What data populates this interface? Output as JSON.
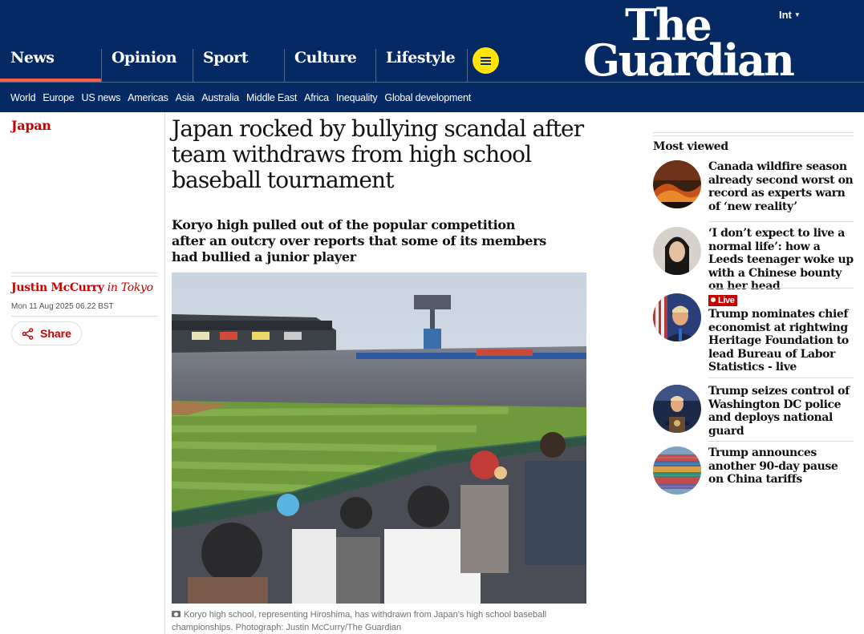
{
  "header": {
    "edition": "Int",
    "logo_line1": "The",
    "logo_line2": "Guardian",
    "pillars": [
      "News",
      "Opinion",
      "Sport",
      "Culture",
      "Lifestyle"
    ],
    "subnav": [
      "World",
      "Europe",
      "US news",
      "Americas",
      "Asia",
      "Australia",
      "Middle East",
      "Africa",
      "Inequality",
      "Global development"
    ],
    "colors": {
      "brand": "#052962",
      "news_accent": "#ff5943",
      "menu_button": "#ffe500"
    }
  },
  "article": {
    "section": "Japan",
    "headline": "Japan rocked by bullying scandal after team withdraws from high school baseball tournament",
    "standfirst": "Koryo high pulled out of the popular competition after an outcry over reports that some of its members had bullied a junior player",
    "author": "Justin McCurry",
    "location": "in Tokyo",
    "date": "Mon 11 Aug 2025 06.22 BST",
    "share_label": "Share",
    "caption": "Koryo high school, representing Hiroshima, has withdrawn from Japan's high school baseball championships. Photograph: Justin McCurry/The Guardian",
    "colors": {
      "section": "#c70000"
    }
  },
  "most_viewed": {
    "title": "Most viewed",
    "items": [
      {
        "text": "Canada wildfire season already second worst on record as experts warn of ‘new reality’",
        "icon": "wildfire-photo"
      },
      {
        "text": "‘I don’t expect to live a normal life’: how a Leeds teenager woke up with a Chinese bounty on her head",
        "icon": "portrait-photo"
      },
      {
        "live": "Live",
        "text": "Trump nominates chief economist at rightwing Heritage Foundation to lead Bureau of Labor Statistics - live",
        "icon": "trump-photo"
      },
      {
        "text": "Trump seizes control of Washington DC police and deploys national guard",
        "icon": "press-conference-photo"
      },
      {
        "text": "Trump announces another 90-day pause on China tariffs",
        "icon": "shipping-containers-photo"
      }
    ]
  }
}
